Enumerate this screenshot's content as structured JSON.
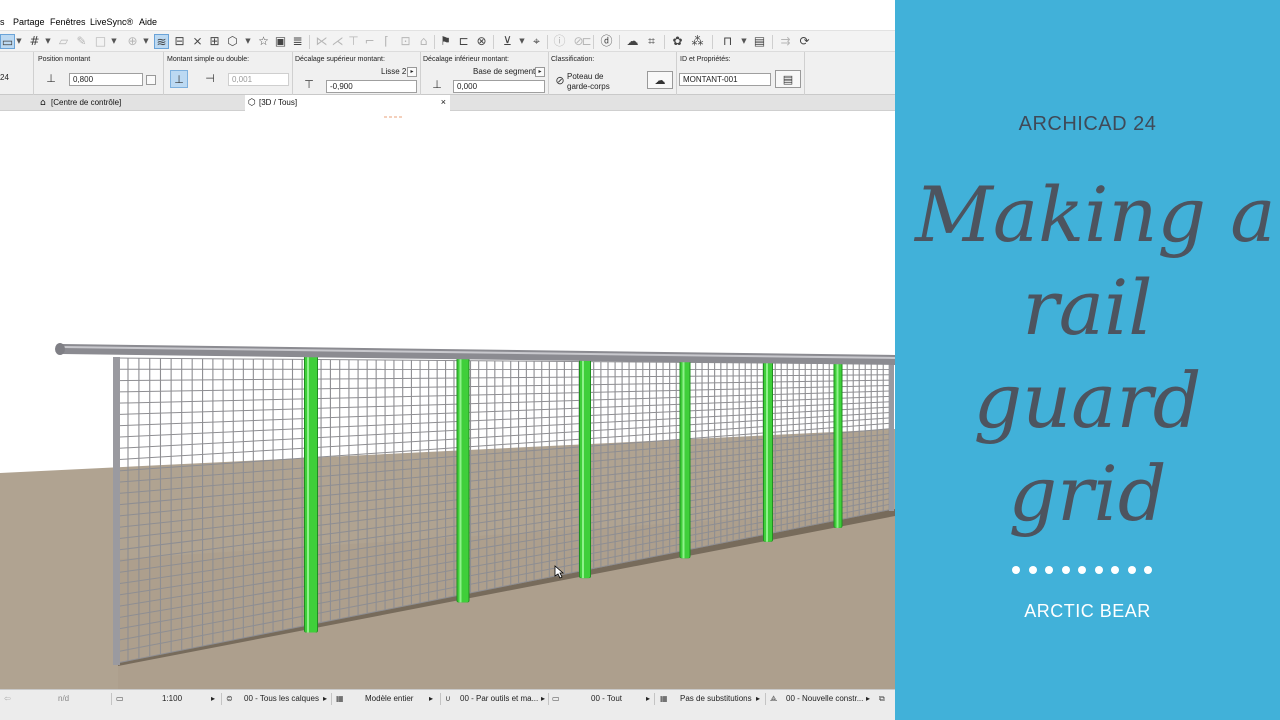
{
  "menubar": {
    "items": [
      "s",
      "Partage",
      "Fenêtres",
      "LiveSync®",
      "Aide"
    ]
  },
  "toolbar": {
    "icons": [
      "floor-plan-icon",
      "grid-icon",
      "snap-icon",
      "pen-icon",
      "shape-icon",
      "lock-icon",
      "magic-wand-icon",
      "guide-line-icon",
      "dimension-icon",
      "cross-icon",
      "marquee-icon",
      "cube-icon",
      "star-icon",
      "image-icon",
      "stack-icon",
      "trim-icon",
      "adjust-icon",
      "intersect-icon",
      "fillet-icon",
      "offset-icon",
      "roof-icon",
      "flag-icon",
      "plan-icon",
      "package-icon",
      "split-icon",
      "paint-bucket-icon",
      "info-icon",
      "arrange-icon",
      "id-icon",
      "cloud-icon",
      "tag-icon",
      "palette-icon",
      "shuffle-icon",
      "rail-icon",
      "book-icon",
      "layers-icon",
      "sync-icon"
    ]
  },
  "infobox": {
    "segment_count": "24",
    "position_label": "Position montant",
    "position_value": "0,800",
    "simple_double_label": "Montant simple ou double:",
    "simple_double_value": "0,001",
    "top_offset_label": "Décalage supérieur montant:",
    "top_offset_ref": "Lisse 2",
    "top_offset_value": "-0,900",
    "bottom_offset_label": "Décalage inférieur montant:",
    "bottom_offset_ref": "Base de segment",
    "bottom_offset_value": "0,000",
    "classification_label": "Classification:",
    "classification_line1": "Poteau de",
    "classification_line2": "garde-corps",
    "id_label": "ID et Propriétés:",
    "id_value": "MONTANT-001"
  },
  "tabs": [
    {
      "label": "[Centre de contrôle]",
      "icon": "control-center-icon"
    },
    {
      "label": "[3D / Tous]",
      "icon": "3d-view-icon",
      "close": "×"
    }
  ],
  "statusbar": {
    "nd": "n/d",
    "scale": "1:100",
    "layers": "00 - Tous les calques",
    "model": "Modèle entier",
    "pens": "00 - Par outils et ma...",
    "all": "00 - Tout",
    "overrides": "Pas de substitutions",
    "renovation": "00 - Nouvelle constr..."
  },
  "colors": {
    "panel_bg": "#41b1d9",
    "title_text": "#4d545f",
    "post_highlight": "#3fcf3a",
    "ground": "#b0a391"
  },
  "title_panel": {
    "product": "ARCHICAD 24",
    "title_lines": [
      "Making a",
      "rail",
      "guard",
      "grid"
    ],
    "author": "ARCTIC BEAR",
    "dot_count": 9
  }
}
